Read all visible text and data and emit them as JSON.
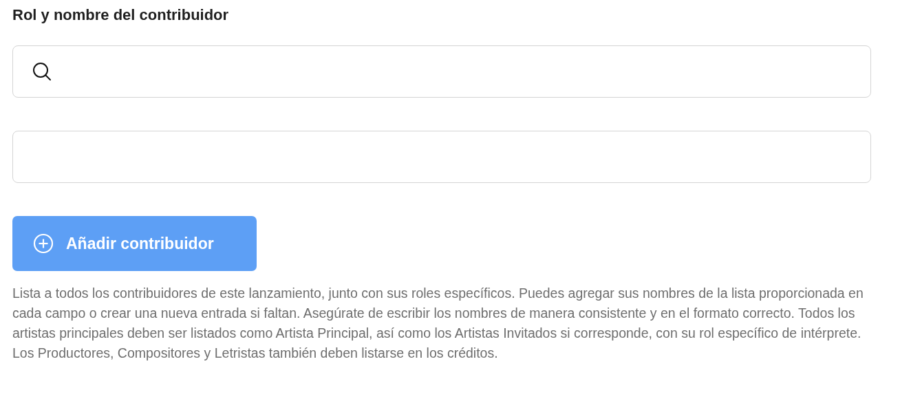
{
  "section": {
    "title": "Rol y nombre del contribuidor"
  },
  "fields": [
    {
      "kind": "search"
    },
    {
      "kind": "text"
    }
  ],
  "add_button": {
    "label": "Añadir contribuidor",
    "disabled": true
  },
  "help_text": "Lista a todos los contribuidores de este lanzamiento, junto con sus roles específicos. Puedes agregar sus nombres de la lista proporcionada en cada campo o crear una nueva entrada si faltan. Asegúrate de escribir los nombres de manera consistente y en el formato correcto. Todos los artistas principales deben ser listados como Artista Principal, así como los Artistas Invitados si corresponde, con su rol específico de intérprete. Los Productores, Compositores y Letristas también deben listarse en los créditos."
}
